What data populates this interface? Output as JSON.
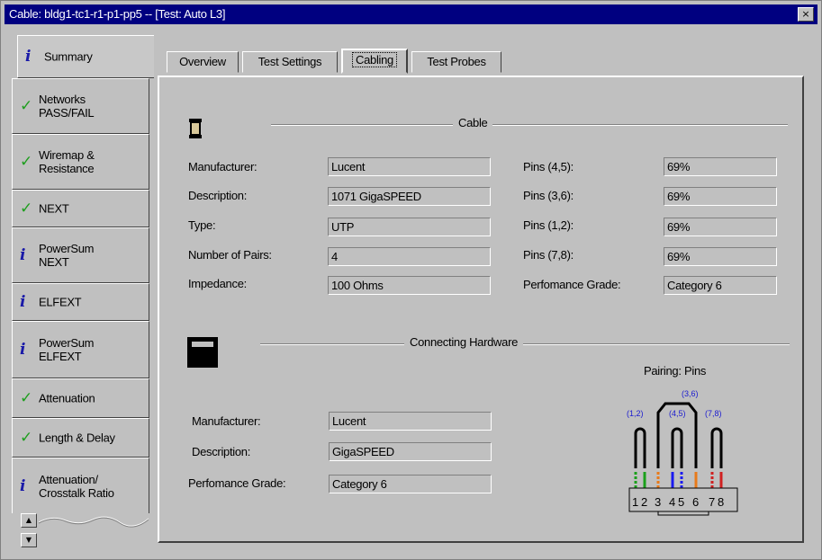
{
  "window": {
    "title": "Cable: bldg1-tc1-r1-p1-pp5 -- [Test: Auto L3]",
    "close_glyph": "×"
  },
  "sidebar": {
    "items": [
      {
        "label": "Summary",
        "icon": "info-icon"
      },
      {
        "label": "Networks\nPASS/FAIL",
        "icon": "check-icon"
      },
      {
        "label": "Wiremap &\nResistance",
        "icon": "check-icon"
      },
      {
        "label": "NEXT",
        "icon": "check-icon"
      },
      {
        "label": "PowerSum\nNEXT",
        "icon": "info-icon"
      },
      {
        "label": "ELFEXT",
        "icon": "info-icon"
      },
      {
        "label": "PowerSum\nELFEXT",
        "icon": "info-icon"
      },
      {
        "label": "Attenuation",
        "icon": "check-icon"
      },
      {
        "label": "Length & Delay",
        "icon": "check-icon"
      },
      {
        "label": "Attenuation/\nCrosstalk Ratio",
        "icon": "info-icon"
      }
    ],
    "check_glyph": "✓",
    "info_glyph": "i",
    "scroll_up": "▲",
    "scroll_down": "▼"
  },
  "tabs": [
    "Overview",
    "Test Settings",
    "Cabling",
    "Test Probes"
  ],
  "active_tab": "Cabling",
  "cable": {
    "heading": "Cable",
    "manufacturer_label": "Manufacturer:",
    "manufacturer": "Lucent",
    "description_label": "Description:",
    "description": "1071 GigaSPEED",
    "type_label": "Type:",
    "type": "UTP",
    "pairs_label": "Number of Pairs:",
    "pairs": "4",
    "impedance_label": "Impedance:",
    "impedance": "100 Ohms",
    "pins45_label": "Pins (4,5):",
    "pins45": "69%",
    "pins36_label": "Pins (3,6):",
    "pins36": "69%",
    "pins12_label": "Pins (1,2):",
    "pins12": "69%",
    "pins78_label": "Pins (7,8):",
    "pins78": "69%",
    "grade_label": "Perfomance Grade:",
    "grade": "Category 6"
  },
  "hardware": {
    "heading": "Connecting Hardware",
    "manufacturer_label": "Manufacturer:",
    "manufacturer": "Lucent",
    "description_label": "Description:",
    "description": "GigaSPEED",
    "grade_label": "Perfomance Grade:",
    "grade": "Category 6"
  },
  "pairing": {
    "title": "Pairing: Pins",
    "pair_labels": [
      "(1,2)",
      "(3,6)",
      "(4,5)",
      "(7,8)"
    ],
    "pin_numbers": [
      "1",
      "2",
      "3",
      "4",
      "5",
      "6",
      "7",
      "8"
    ],
    "colors": {
      "pair12": "#1aa01a",
      "pair36": "#e87a1a",
      "pair45": "#1a1af0",
      "pair78": "#d02020",
      "pair_label": "#1a1ad0"
    }
  }
}
